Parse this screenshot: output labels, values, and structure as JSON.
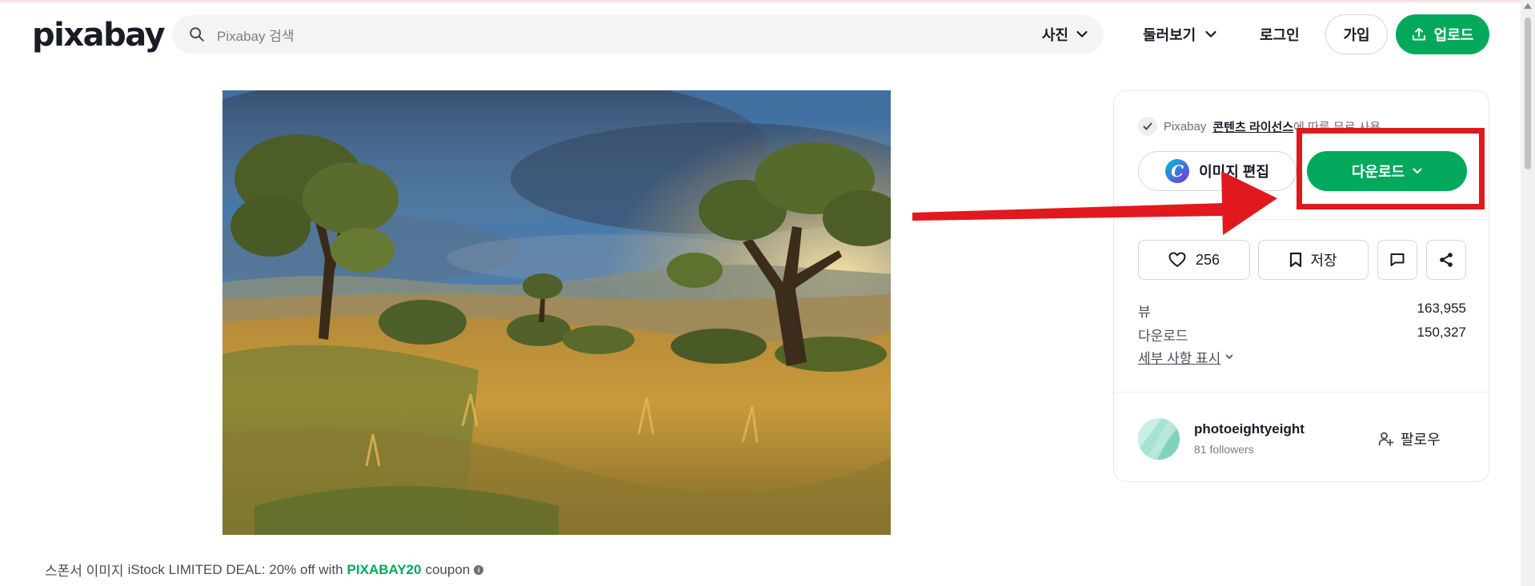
{
  "header": {
    "logo_text": "pixabay",
    "search_placeholder": "Pixabay 검색",
    "search_filter": "사진",
    "explore_label": "둘러보기",
    "login_label": "로그인",
    "join_label": "가입",
    "upload_label": "업로드"
  },
  "photo": {
    "subject": "Golden-hour grassland landscape with eucalyptus trees under a stormy blue sky"
  },
  "panel": {
    "license_prefix": "Pixabay",
    "license_link": "콘텐츠 라이선스",
    "license_suffix": "에 따른 무료 사용",
    "edit_label": "이미지 편집",
    "download_label": "다운로드",
    "likes": "256",
    "save_label": "저장",
    "stats": [
      {
        "label": "뷰",
        "value": "163,955"
      },
      {
        "label": "다운로드",
        "value": "150,327"
      }
    ],
    "details_label": "세부 사항 표시",
    "user": {
      "name": "photoeightyeight",
      "followers": "81 followers",
      "follow_label": "팔로우"
    }
  },
  "sponsor": {
    "label": "스폰서 이미지",
    "text": "iStock LIMITED DEAL: 20% off with",
    "code": "PIXABAY20",
    "suffix": "coupon"
  },
  "colors": {
    "brand_green": "#02a95c",
    "annotation_red": "#e1191e"
  },
  "icons": {
    "search": "search-icon",
    "chevron": "chevron-down-icon",
    "upload": "upload-icon",
    "heart": "heart-icon",
    "bookmark": "bookmark-icon",
    "comment": "comment-icon",
    "share": "share-icon",
    "follow": "follow-user-icon",
    "check": "check-icon"
  }
}
